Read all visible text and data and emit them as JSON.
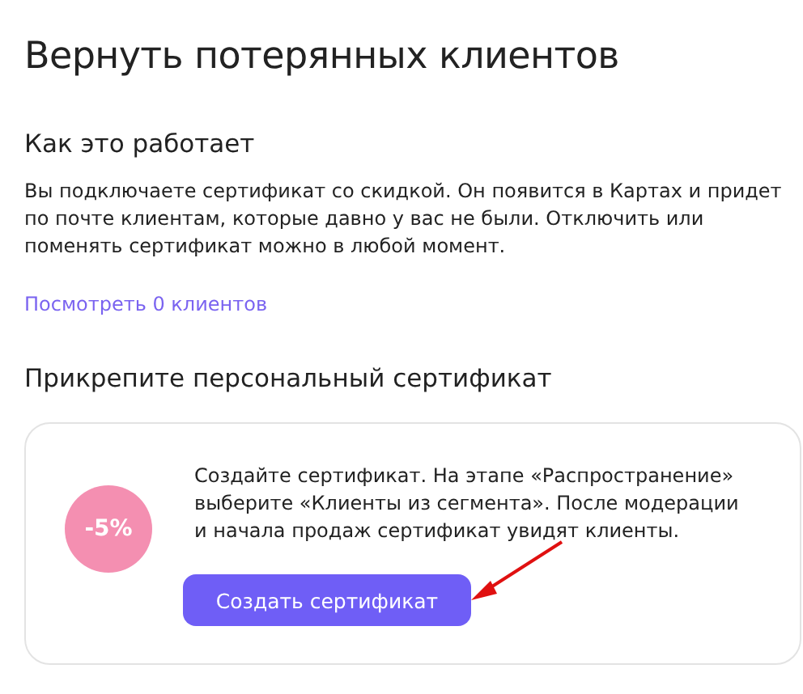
{
  "title": "Вернуть потерянных клиентов",
  "how": {
    "heading": "Как это работает",
    "text": "Вы подключаете сертификат со скидкой. Он появится в Картах и придет по почте клиентам, которые давно у вас не были. Отключить или поменять сертификат можно в любой момент.",
    "link": "Посмотреть 0 клиентов"
  },
  "attach": {
    "heading": "Прикрепите персональный сертификат",
    "card": {
      "badge": "-5%",
      "text": "Создайте сертификат. На этапе «Распространение» выберите «Клиенты из сегмента». После модерации и начала продаж сертификат увидят клиенты.",
      "button": "Создать сертификат"
    }
  }
}
